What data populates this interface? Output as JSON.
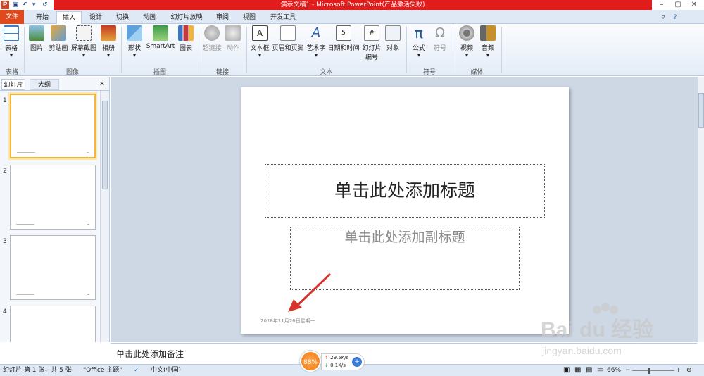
{
  "window": {
    "title": "演示文稿1 - Microsoft PowerPoint(产品激活失败)"
  },
  "tabs": [
    "文件",
    "开始",
    "插入",
    "设计",
    "切换",
    "动画",
    "幻灯片放映",
    "审阅",
    "视图",
    "开发工具"
  ],
  "ribbon": {
    "table": "表格",
    "picture": "图片",
    "clipart": "剪贴画",
    "screenshot": "屏幕截图",
    "album": "相册",
    "shapes": "形状",
    "smartart": "SmartArt",
    "chart": "图表",
    "hyperlink": "超链接",
    "action": "动作",
    "textbox": "文本框",
    "headerfooter": "页眉和页脚",
    "wordart": "艺术字",
    "datetime": "日期和时间",
    "slidenum1": "幻灯片",
    "slidenum2": "编号",
    "object": "对象",
    "equation": "公式",
    "symbol": "符号",
    "video": "视频",
    "audio": "音频",
    "g_table": "表格",
    "g_image": "图像",
    "g_illus": "插图",
    "g_link": "链接",
    "g_text": "文本",
    "g_symbol": "符号",
    "g_media": "媒体"
  },
  "panel": {
    "tab_slides": "幻灯片",
    "tab_outline": "大纲",
    "close": "✕",
    "nums": [
      "1",
      "2",
      "3",
      "4"
    ]
  },
  "slide": {
    "title": "单击此处添加标题",
    "subtitle": "单击此处添加副标题",
    "date": "2018年11月26日星期一"
  },
  "notes": {
    "placeholder": "单击此处添加备注"
  },
  "status": {
    "slide": "幻灯片 第 1 张，共 5 张",
    "theme": "\"Office 主题\"",
    "lang": "中文(中国)",
    "zoom": "66%",
    "widget_pct": "88%",
    "up": "29.5K/s",
    "down": "0.1K/s"
  },
  "watermark": {
    "brand": "Bai du 经验",
    "url": "jingyan.baidu.com"
  },
  "colors": {
    "title_bar": "#e21b1b",
    "file_tab": "#e0491e",
    "annotation_arrow": "#d9342b"
  }
}
